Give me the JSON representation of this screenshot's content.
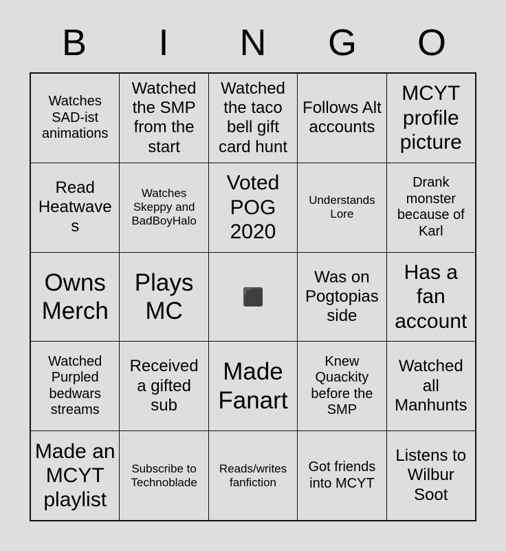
{
  "header": {
    "letters": [
      "B",
      "I",
      "N",
      "G",
      "O"
    ]
  },
  "colors": {
    "background": "#dedede",
    "cell_background": "#dedede",
    "grid_line": "#111111",
    "text": "#000000",
    "free_stamp": "#3f3f3f"
  },
  "grid": {
    "rows": 5,
    "columns": 5,
    "cells": [
      {
        "text": "Watches SAD-ist animations",
        "size": "sm",
        "marked": false
      },
      {
        "text": "Watched the SMP from the start",
        "size": "md",
        "marked": false
      },
      {
        "text": "Watched the taco bell gift card hunt",
        "size": "md",
        "marked": false
      },
      {
        "text": "Follows Alt accounts",
        "size": "md",
        "marked": false
      },
      {
        "text": "MCYT profile picture",
        "size": "lg",
        "marked": false
      },
      {
        "text": "Read Heatwaves",
        "size": "md",
        "marked": false
      },
      {
        "text": "Watches Skeppy and BadBoyHalo",
        "size": "xs",
        "marked": false
      },
      {
        "text": "Voted POG 2020",
        "size": "lg",
        "marked": false
      },
      {
        "text": "Understands Lore",
        "size": "xs",
        "marked": false
      },
      {
        "text": "Drank monster because of Karl",
        "size": "sm",
        "marked": false
      },
      {
        "text": "Owns Merch",
        "size": "xl",
        "marked": false
      },
      {
        "text": "Plays MC",
        "size": "xl",
        "marked": false
      },
      {
        "text": "",
        "size": "md",
        "marked": true,
        "free_space": true
      },
      {
        "text": "Was on Pogtopias side",
        "size": "md",
        "marked": false
      },
      {
        "text": "Has a fan account",
        "size": "lg",
        "marked": false
      },
      {
        "text": "Watched Purpled bedwars streams",
        "size": "sm",
        "marked": false
      },
      {
        "text": "Received a gifted sub",
        "size": "md",
        "marked": false
      },
      {
        "text": "Made Fanart",
        "size": "xl",
        "marked": false
      },
      {
        "text": "Knew Quackity before the SMP",
        "size": "sm",
        "marked": false
      },
      {
        "text": "Watched all Manhunts",
        "size": "md",
        "marked": false
      },
      {
        "text": "Made an MCYT playlist",
        "size": "lg",
        "marked": false
      },
      {
        "text": "Subscribe to Technoblade",
        "size": "xs",
        "marked": false
      },
      {
        "text": "Reads/writes fanfiction",
        "size": "xs",
        "marked": false
      },
      {
        "text": "Got friends into MCYT",
        "size": "sm",
        "marked": false
      },
      {
        "text": "Listens to Wilbur Soot",
        "size": "md",
        "marked": false
      }
    ]
  }
}
